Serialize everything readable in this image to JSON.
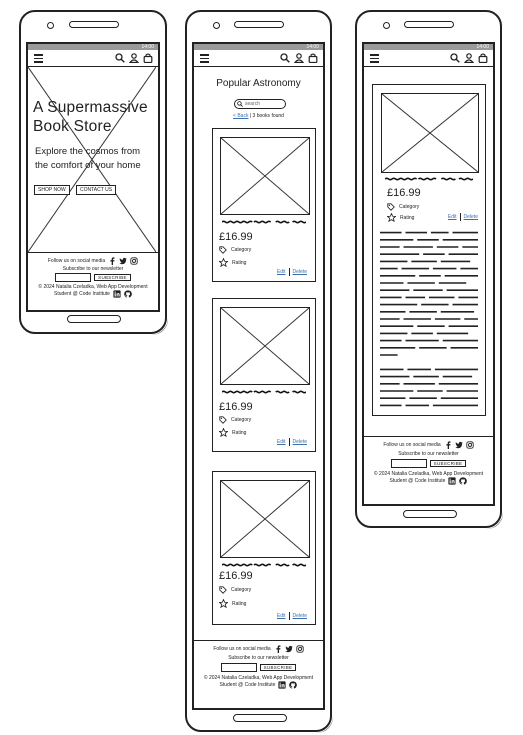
{
  "status_time": "14:00",
  "icons": {
    "menu": "hamburger-icon",
    "search": "search-icon",
    "account": "account-icon",
    "bag": "bag-icon",
    "tag": "tag-icon",
    "star": "star-icon",
    "facebook": "facebook-icon",
    "twitter": "twitter-icon",
    "instagram": "instagram-icon",
    "linkedin": "linkedin-icon",
    "github": "github-icon"
  },
  "home": {
    "heading_line1": "A Supermassive",
    "heading_line2": "Book Store",
    "tagline_line1": "Explore the cosmos from",
    "tagline_line2": "the comfort of your home",
    "shop_button": "SHOP NOW",
    "contact_button": "CONTACT US"
  },
  "products": {
    "title": "Popular Astronomy",
    "search_placeholder": "search",
    "back_link": "< Back",
    "found_text": "| 3 books found",
    "cards": [
      {
        "price": "£16.99",
        "category": "Category",
        "rating": "Rating",
        "edit": "Edit",
        "delete": "Delete"
      },
      {
        "price": "£16.99",
        "category": "Category",
        "rating": "Rating",
        "edit": "Edit",
        "delete": "Delete"
      },
      {
        "price": "£16.99",
        "category": "Category",
        "rating": "Rating",
        "edit": "Edit",
        "delete": "Delete"
      }
    ]
  },
  "detail": {
    "price": "£16.99",
    "category": "Category",
    "rating": "Rating",
    "edit": "Edit",
    "delete": "Delete"
  },
  "footer": {
    "follow": "Follow us on social media",
    "subscribe_text": "Subscribe to our newsletter",
    "subscribe_button": "SUBSCRIBE",
    "copyright": "© 2024 Natalia Czeladka, Web App Development",
    "student": "Student @ Code Institute"
  }
}
